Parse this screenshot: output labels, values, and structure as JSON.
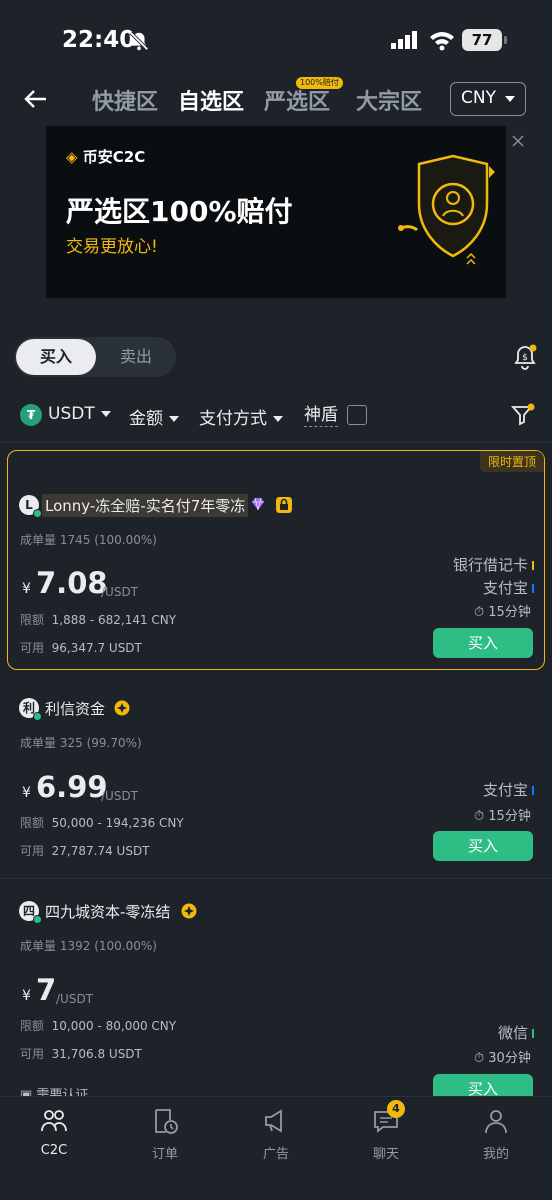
{
  "status": {
    "time": "22:40",
    "battery": "77"
  },
  "nav": {
    "tabs": [
      "快捷区",
      "自选区",
      "严选区",
      "大宗区"
    ],
    "active_tab": "自选区",
    "tab_badge": "100%赔付",
    "currency": "CNY"
  },
  "banner": {
    "logo": "币安C2C",
    "title": "严选区100%赔付",
    "subtitle": "交易更放心!"
  },
  "trade_toggle": {
    "buy": "买入",
    "sell": "卖出"
  },
  "filters": {
    "asset": "USDT",
    "amount": "金额",
    "payment": "支付方式",
    "shield": "神盾"
  },
  "listings": [
    {
      "pinned_label": "限时置顶",
      "avatar": "L",
      "name": "Lonny-冻全赔-实名付7年零冻",
      "orders_label": "成单量",
      "orders": "1745 (100.00%)",
      "currency_symbol": "¥",
      "price": "7.08",
      "unit": "/USDT",
      "limit_label": "限额",
      "limit": "1,888 - 682,141 CNY",
      "available_label": "可用",
      "available": "96,347.7 USDT",
      "payments": [
        "银行借记卡",
        "支付宝"
      ],
      "time": "15分钟",
      "action": "买入"
    },
    {
      "avatar": "利",
      "name": "利信资金",
      "orders_label": "成单量",
      "orders": "325 (99.70%)",
      "currency_symbol": "¥",
      "price": "6.99",
      "unit": "/USDT",
      "limit_label": "限额",
      "limit": "50,000 - 194,236 CNY",
      "available_label": "可用",
      "available": "27,787.74 USDT",
      "payments": [
        "支付宝"
      ],
      "time": "15分钟",
      "action": "买入"
    },
    {
      "avatar": "四",
      "name": "四九城资本-零冻结",
      "orders_label": "成单量",
      "orders": "1392 (100.00%)",
      "currency_symbol": "¥",
      "price": "7",
      "unit": "/USDT",
      "limit_label": "限额",
      "limit": "10,000 - 80,000 CNY",
      "available_label": "可用",
      "available": "31,706.8 USDT",
      "payments": [
        "微信"
      ],
      "time": "30分钟",
      "action": "买入",
      "requirement": "需要认证"
    }
  ],
  "bottom_nav": {
    "items": [
      "C2C",
      "订单",
      "广告",
      "聊天",
      "我的"
    ],
    "chat_badge": "4"
  },
  "colors": {
    "accent": "#f0b90b",
    "buy": "#2ebd85",
    "bg": "#1e2329",
    "alipay": "#1677ff",
    "bank": "#f0b90b",
    "wechat": "#2ebd85"
  }
}
